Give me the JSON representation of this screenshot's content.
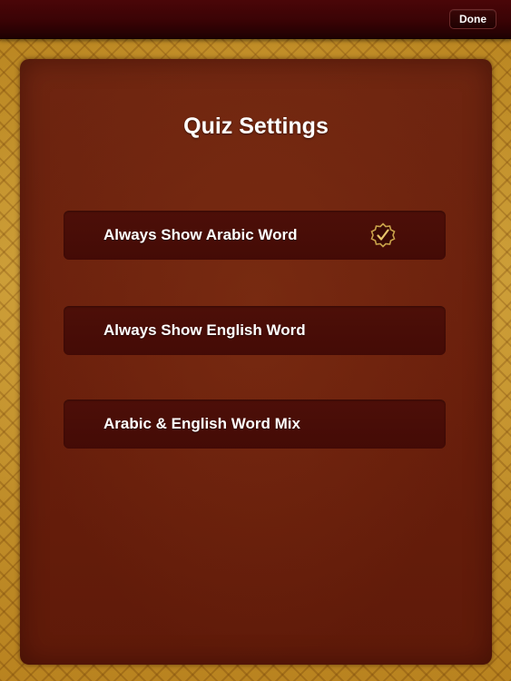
{
  "toolbar": {
    "done_label": "Done"
  },
  "panel": {
    "title": "Quiz Settings",
    "options": [
      {
        "label": "Always Show Arabic Word",
        "selected": true,
        "icon": "check-icon"
      },
      {
        "label": "Always Show English Word",
        "selected": false
      },
      {
        "label": "Arabic & English Word Mix",
        "selected": false
      }
    ]
  },
  "colors": {
    "top_bar": "#3a0305",
    "panel": "#6a1f0c",
    "option_row": "#4a0d07",
    "background_gold": "#b9841f",
    "check_accent": "#c9a24a"
  }
}
